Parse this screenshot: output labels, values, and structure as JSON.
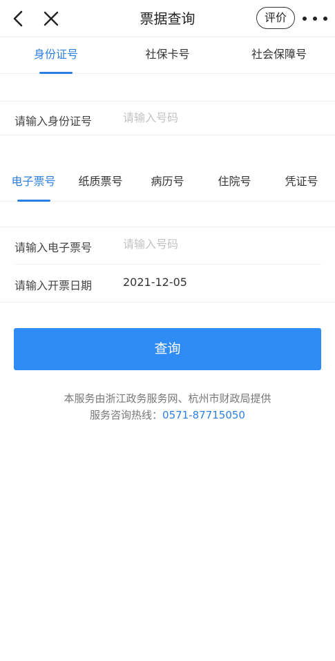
{
  "header": {
    "title": "票据查询",
    "rate_label": "评价"
  },
  "id_tabs": [
    {
      "label": "身份证号",
      "active": true
    },
    {
      "label": "社保卡号",
      "active": false
    },
    {
      "label": "社会保障号",
      "active": false
    }
  ],
  "id_field": {
    "label": "请输入身份证号",
    "placeholder": "请输入号码",
    "value": ""
  },
  "bill_tabs": [
    {
      "label": "电子票号",
      "active": true
    },
    {
      "label": "纸质票号",
      "active": false
    },
    {
      "label": "病历号",
      "active": false
    },
    {
      "label": "住院号",
      "active": false
    },
    {
      "label": "凭证号",
      "active": false
    }
  ],
  "bill_field": {
    "label": "请输入电子票号",
    "placeholder": "请输入号码",
    "value": ""
  },
  "date_field": {
    "label": "请输入开票日期",
    "value": "2021-12-05"
  },
  "query_button": "查询",
  "footer": {
    "provider": "本服务由浙江政务服务网、杭州市财政局提供",
    "hotline_label": "服务咨询热线：",
    "hotline_number": "0571-87715050"
  },
  "colors": {
    "accent": "#2c7fe0",
    "button": "#2e8cf4"
  },
  "icons": [
    "back-chevron-icon",
    "close-x-icon",
    "more-dots-icon"
  ]
}
